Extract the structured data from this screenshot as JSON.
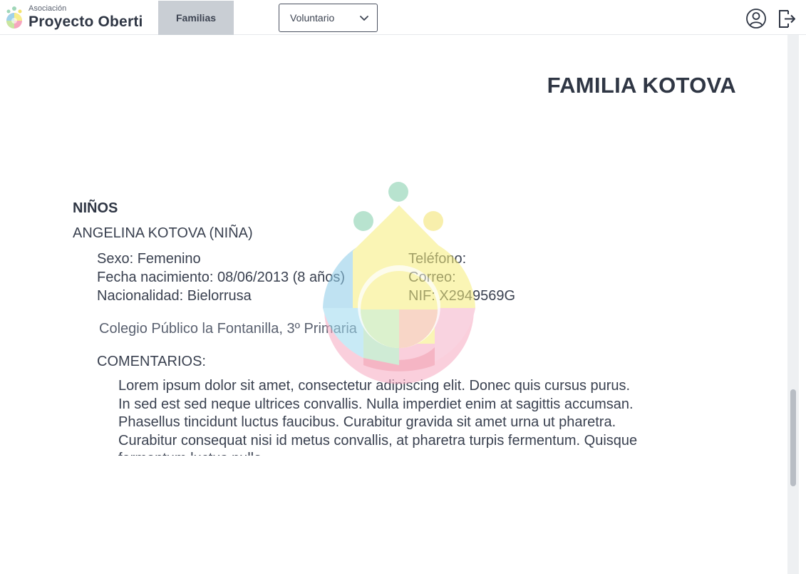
{
  "header": {
    "brand_small": "Asociación",
    "brand_name": "Proyecto Oberti",
    "nav_tab_label": "Familias",
    "role_select_value": "Voluntario",
    "user_icon": "user-circle-icon",
    "logout_icon": "logout-icon"
  },
  "family": {
    "title": "FAMILIA KOTOVA"
  },
  "children_section": {
    "title": "NIÑOS",
    "children": [
      {
        "name": "ANGELINA KOTOVA (NIÑA)",
        "sex": "Sexo: Femenino",
        "birth": "Fecha nacimiento: 08/06/2013 (8 años)",
        "nationality": "Nacionalidad: Bielorrusa",
        "phone": "Teléfono:",
        "email": "Correo:",
        "nif": "NIF: X2949569G",
        "school": "Colegio Público la Fontanilla, 3º Primaria",
        "comments_label": "COMENTARIOS:",
        "comments": "Lorem ipsum dolor sit amet, consectetur adipiscing elit. Donec quis cursus purus. In sed est sed neque ultrices convallis. Nulla imperdiet enim at sagittis accumsan. Phasellus tincidunt luctus faucibus. Curabitur gravida sit amet urna ut pharetra. Curabitur consequat nisi id metus convallis, at pharetra turpis fermentum. Quisque fermentum luctus nulla."
      }
    ]
  },
  "colors": {
    "header_tab_bg": "#c9ced4",
    "text_dark": "#2f3644",
    "scroll_thumb": "#b8bdc4"
  }
}
